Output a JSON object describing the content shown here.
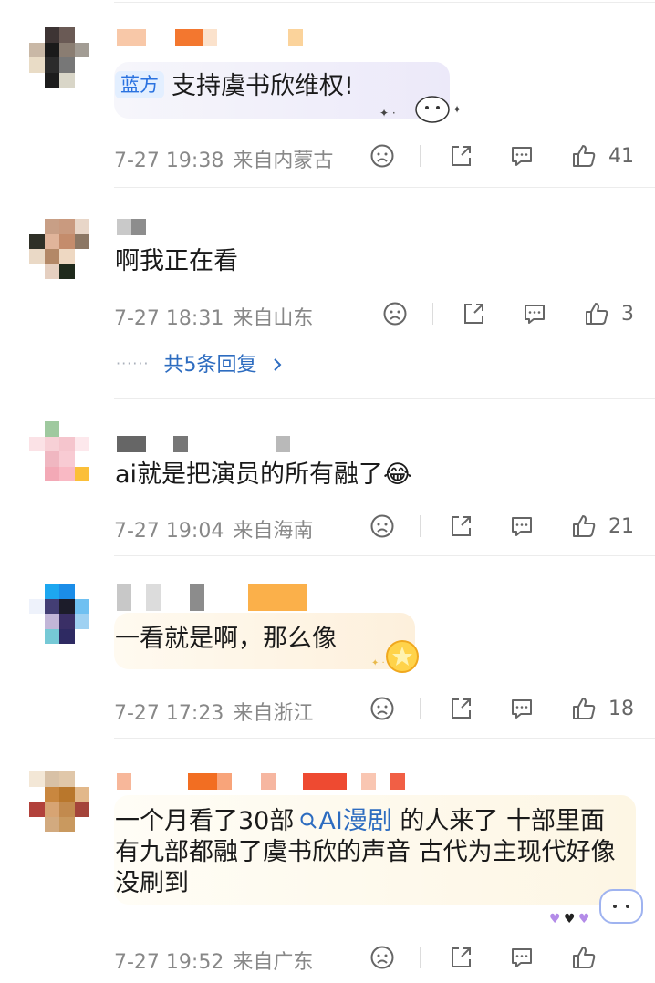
{
  "comments": [
    {
      "tag": "蓝方",
      "text": "支持虞书欣维权!",
      "date": "7-27 19:38",
      "location": "来自内蒙古",
      "likes": "41"
    },
    {
      "text": "啊我正在看",
      "date": "7-27 18:31",
      "location": "来自山东",
      "likes": "3",
      "replies_label": "共5条回复",
      "replies_dots": "······"
    },
    {
      "text": "ai就是把演员的所有融了😂",
      "date": "7-27 19:04",
      "location": "来自海南",
      "likes": "21"
    },
    {
      "text": "一看就是啊，那么像",
      "date": "7-27 17:23",
      "location": "来自浙江",
      "likes": "18"
    },
    {
      "text_before": "一个月看了30部",
      "link": "AI漫剧",
      "text_after": "的人来了 十部里面有九部都融了虞书欣的声音 古代为主现代好像没刷到",
      "date": "7-27 19:52",
      "location": "来自广东"
    }
  ],
  "icons": {
    "dislike": "frown-face-icon",
    "share": "share-icon",
    "comment": "comment-bubble-icon",
    "like": "thumbs-up-icon",
    "search": "search-icon"
  },
  "colors": {
    "link": "#2d6cc0",
    "tag_bg": "#e3efff",
    "meta": "#888888"
  }
}
